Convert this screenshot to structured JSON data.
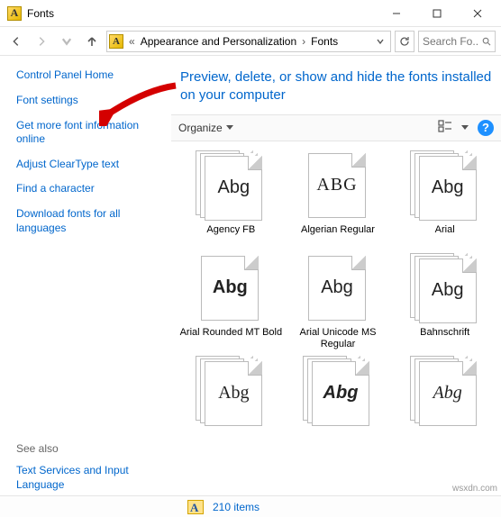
{
  "window": {
    "title": "Fonts"
  },
  "breadcrumbs": {
    "prefix": "«",
    "items": [
      "Appearance and Personalization",
      "Fonts"
    ]
  },
  "search": {
    "placeholder": "Search Fo..."
  },
  "sidebar": {
    "home": "Control Panel Home",
    "links": [
      "Font settings",
      "Get more font information online",
      "Adjust ClearType text",
      "Find a character",
      "Download fonts for all languages"
    ],
    "see_also_label": "See also",
    "see_also_links": [
      "Text Services and Input Language"
    ]
  },
  "main": {
    "heading": "Preview, delete, or show and hide the fonts installed on your computer",
    "organize": "Organize"
  },
  "fonts": [
    {
      "name": "Agency FB",
      "sample": "Abg",
      "stack": true,
      "css": "font-family:'Agency FB','Arial Narrow',sans-serif;font-stretch:condensed;"
    },
    {
      "name": "Algerian Regular",
      "sample": "ABG",
      "stack": false,
      "css": "font-family:'Algerian','Times New Roman',serif;letter-spacing:1px;"
    },
    {
      "name": "Arial",
      "sample": "Abg",
      "stack": true,
      "css": "font-family:Arial,sans-serif;"
    },
    {
      "name": "Arial Rounded MT Bold",
      "sample": "Abg",
      "stack": false,
      "css": "font-family:'Arial Rounded MT Bold',Arial,sans-serif;font-weight:bold;"
    },
    {
      "name": "Arial Unicode MS Regular",
      "sample": "Abg",
      "stack": false,
      "css": "font-family:'Arial Unicode MS',Arial,sans-serif;"
    },
    {
      "name": "Bahnschrift",
      "sample": "Abg",
      "stack": true,
      "css": "font-family:'Bahnschrift',Arial,sans-serif;"
    },
    {
      "name": "",
      "sample": "Abg",
      "stack": true,
      "css": "font-family:'Times New Roman',serif;"
    },
    {
      "name": "",
      "sample": "Abg",
      "stack": true,
      "css": "font-family:Impact,Arial Black,sans-serif;font-weight:900;font-style:italic;"
    },
    {
      "name": "",
      "sample": "Abg",
      "stack": true,
      "css": "font-family:'Times New Roman',serif;font-style:italic;"
    }
  ],
  "status": {
    "items": "210 items"
  },
  "watermark": "wsxdn.com"
}
